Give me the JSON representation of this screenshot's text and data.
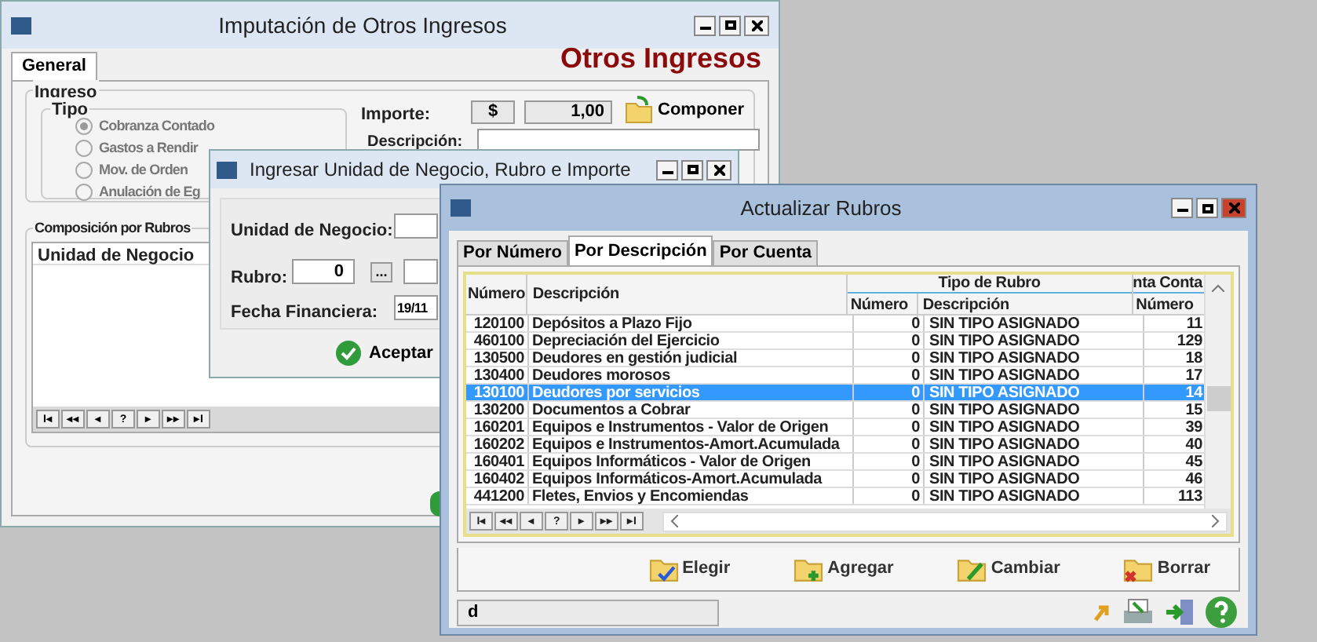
{
  "main_window": {
    "title": "Imputación de Otros Ingresos",
    "heading": "Otros Ingresos",
    "tabs": [
      {
        "label": "General",
        "selected": true
      }
    ],
    "group_title": "Ingreso",
    "tipo": {
      "title": "Tipo",
      "options": [
        {
          "label": "Cobranza Contado",
          "selected": true,
          "disabled": true
        },
        {
          "label": "Gastos a Rendir",
          "selected": false,
          "disabled": true
        },
        {
          "label": "Mov. de Orden",
          "selected": false,
          "disabled": true
        },
        {
          "label": "Anulación de Eg",
          "selected": false,
          "disabled": true
        }
      ]
    },
    "importe_label": "Importe:",
    "currency": "$",
    "importe": "1,00",
    "componer": "Componer",
    "descripcion_label": "Descripción:",
    "composicion_title": "Composición por Rubros",
    "composicion_columns": [
      "Unidad de Negocio"
    ],
    "nav_buttons": [
      "I◂",
      "◂◂",
      "◂",
      "?",
      "▸",
      "▸▸",
      "▸I"
    ]
  },
  "dialog": {
    "title": "Ingresar Unidad de Negocio, Rubro e Importe",
    "unidad_label": "Unidad de Negocio:",
    "rubro_label": "Rubro:",
    "rubro_value": "0",
    "lookup_button": "...",
    "fecha_label": "Fecha Financiera:",
    "fecha_value": "19/11",
    "accept": "Aceptar"
  },
  "rubros_window": {
    "title": "Actualizar Rubros",
    "tabs": [
      {
        "label": "Por Número",
        "selected": false
      },
      {
        "label": "Por Descripción",
        "selected": true
      },
      {
        "label": "Por Cuenta",
        "selected": false
      }
    ],
    "group_header": "Tipo de Rubro",
    "group_header_2": "nta Conta",
    "columns": [
      "Número",
      "Descripción",
      "Número",
      "Descripción",
      "Número"
    ],
    "rows": [
      {
        "numero": "120100",
        "descripcion": "Depósitos a Plazo Fijo",
        "tipo_numero": "0",
        "tipo_descripcion": "SIN TIPO ASIGNADO",
        "cuenta": "11",
        "selected": false
      },
      {
        "numero": "460100",
        "descripcion": "Depreciación del Ejercicio",
        "tipo_numero": "0",
        "tipo_descripcion": "SIN TIPO ASIGNADO",
        "cuenta": "129",
        "selected": false
      },
      {
        "numero": "130500",
        "descripcion": "Deudores en gestión judicial",
        "tipo_numero": "0",
        "tipo_descripcion": "SIN TIPO ASIGNADO",
        "cuenta": "18",
        "selected": false
      },
      {
        "numero": "130400",
        "descripcion": "Deudores morosos",
        "tipo_numero": "0",
        "tipo_descripcion": "SIN TIPO ASIGNADO",
        "cuenta": "17",
        "selected": false
      },
      {
        "numero": "130100",
        "descripcion": "Deudores por servicios",
        "tipo_numero": "0",
        "tipo_descripcion": "SIN TIPO ASIGNADO",
        "cuenta": "14",
        "selected": true
      },
      {
        "numero": "130200",
        "descripcion": "Documentos a Cobrar",
        "tipo_numero": "0",
        "tipo_descripcion": "SIN TIPO ASIGNADO",
        "cuenta": "15",
        "selected": false
      },
      {
        "numero": "160201",
        "descripcion": "Equipos e Instrumentos - Valor de Origen",
        "tipo_numero": "0",
        "tipo_descripcion": "SIN TIPO ASIGNADO",
        "cuenta": "39",
        "selected": false
      },
      {
        "numero": "160202",
        "descripcion": "Equipos e Instrumentos-Amort.Acumulada",
        "tipo_numero": "0",
        "tipo_descripcion": "SIN TIPO ASIGNADO",
        "cuenta": "40",
        "selected": false
      },
      {
        "numero": "160401",
        "descripcion": "Equipos Informáticos - Valor de Origen",
        "tipo_numero": "0",
        "tipo_descripcion": "SIN TIPO ASIGNADO",
        "cuenta": "45",
        "selected": false
      },
      {
        "numero": "160402",
        "descripcion": "Equipos Informáticos-Amort.Acumulada",
        "tipo_numero": "0",
        "tipo_descripcion": "SIN TIPO ASIGNADO",
        "cuenta": "46",
        "selected": false
      },
      {
        "numero": "441200",
        "descripcion": "Fletes, Envios y Encomiendas",
        "tipo_numero": "0",
        "tipo_descripcion": "SIN TIPO ASIGNADO",
        "cuenta": "113",
        "selected": false
      }
    ],
    "nav_buttons": [
      "I◂",
      "◂◂",
      "◂",
      "?",
      "▸",
      "▸▸",
      "▸I"
    ],
    "actions": [
      {
        "label": "Elegir",
        "kind": "choose"
      },
      {
        "label": "Agregar",
        "kind": "add"
      },
      {
        "label": "Cambiar",
        "kind": "edit"
      },
      {
        "label": "Borrar",
        "kind": "delete"
      }
    ],
    "search_value": "d"
  }
}
